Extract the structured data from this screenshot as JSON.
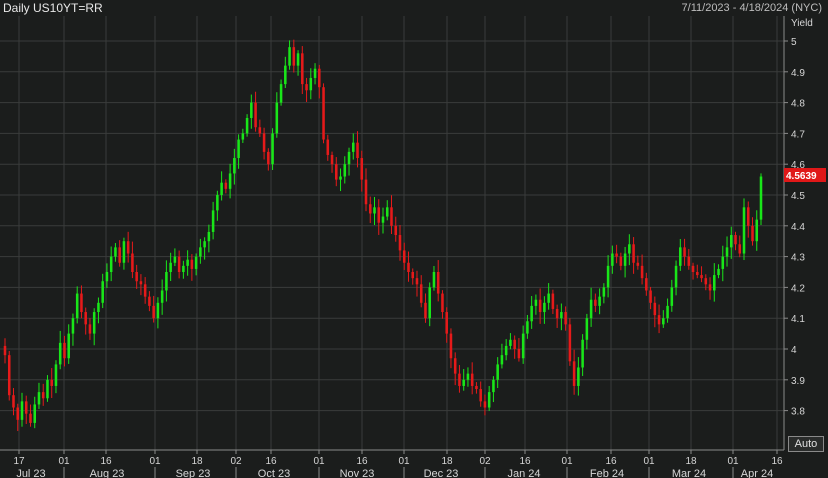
{
  "header": {
    "title": "Daily US10YT=RR",
    "date_range": "7/11/2023 - 4/18/2024 (NYC)"
  },
  "controls": {
    "auto_label": "Auto"
  },
  "colors": {
    "up": "#19e619",
    "down": "#e61a1a",
    "grid": "#3a3c3b",
    "last_price_bg": "#e01818"
  },
  "chart_data": {
    "type": "candlestick",
    "ylabel": "Yield",
    "y_ticks": [
      "5",
      "4.9",
      "4.8",
      "4.7",
      "4.6",
      "4.5",
      "4.4",
      "4.3",
      "4.2",
      "4.1",
      "4",
      "3.9",
      "3.8"
    ],
    "ylim": [
      3.72,
      5.05
    ],
    "last_value": "4.5639",
    "x_day_ticks": [
      "17",
      "01",
      "16",
      "01",
      "18",
      "02",
      "16",
      "01",
      "16",
      "01",
      "18",
      "02",
      "16",
      "01",
      "16",
      "01",
      "18",
      "01",
      "16"
    ],
    "x_months": [
      "Jul 23",
      "Aug 23",
      "Sep 23",
      "Oct 23",
      "Nov 23",
      "Dec 23",
      "Jan 24",
      "Feb 24",
      "Mar 24",
      "Apr 24"
    ],
    "closes": [
      3.98,
      3.85,
      3.81,
      3.77,
      3.83,
      3.79,
      3.76,
      3.82,
      3.86,
      3.84,
      3.9,
      3.88,
      3.95,
      4.02,
      3.97,
      4.05,
      4.1,
      4.18,
      4.12,
      4.08,
      4.05,
      4.12,
      4.15,
      4.22,
      4.25,
      4.3,
      4.33,
      4.28,
      4.35,
      4.31,
      4.25,
      4.22,
      4.21,
      4.17,
      4.14,
      4.1,
      4.15,
      4.19,
      4.25,
      4.28,
      4.3,
      4.25,
      4.27,
      4.29,
      4.26,
      4.3,
      4.33,
      4.35,
      4.38,
      4.45,
      4.5,
      4.54,
      4.52,
      4.57,
      4.62,
      4.68,
      4.7,
      4.75,
      4.8,
      4.72,
      4.7,
      4.64,
      4.6,
      4.7,
      4.8,
      4.86,
      4.92,
      4.98,
      4.92,
      4.96,
      4.86,
      4.84,
      4.88,
      4.91,
      4.85,
      4.68,
      4.63,
      4.6,
      4.55,
      4.56,
      4.6,
      4.64,
      4.67,
      4.62,
      4.55,
      4.47,
      4.44,
      4.46,
      4.41,
      4.43,
      4.46,
      4.4,
      4.37,
      4.32,
      4.28,
      4.25,
      4.23,
      4.21,
      4.15,
      4.1,
      4.2,
      4.25,
      4.18,
      4.12,
      4.05,
      3.97,
      3.92,
      3.88,
      3.9,
      3.92,
      3.88,
      3.87,
      3.83,
      3.81,
      3.86,
      3.9,
      3.95,
      3.98,
      4.01,
      4.03,
      4.0,
      3.97,
      4.05,
      4.09,
      4.14,
      4.16,
      4.12,
      4.15,
      4.18,
      4.13,
      4.1,
      4.12,
      4.08,
      3.96,
      3.88,
      3.94,
      4.03,
      4.1,
      4.16,
      4.14,
      4.17,
      4.2,
      4.27,
      4.31,
      4.3,
      4.27,
      4.31,
      4.34,
      4.28,
      4.27,
      4.23,
      4.19,
      4.15,
      4.11,
      4.08,
      4.1,
      4.14,
      4.2,
      4.27,
      4.33,
      4.3,
      4.27,
      4.25,
      4.24,
      4.23,
      4.21,
      4.19,
      4.24,
      4.26,
      4.3,
      4.33,
      4.37,
      4.34,
      4.31,
      4.46,
      4.4,
      4.35,
      4.42,
      4.56
    ],
    "grid": true
  }
}
